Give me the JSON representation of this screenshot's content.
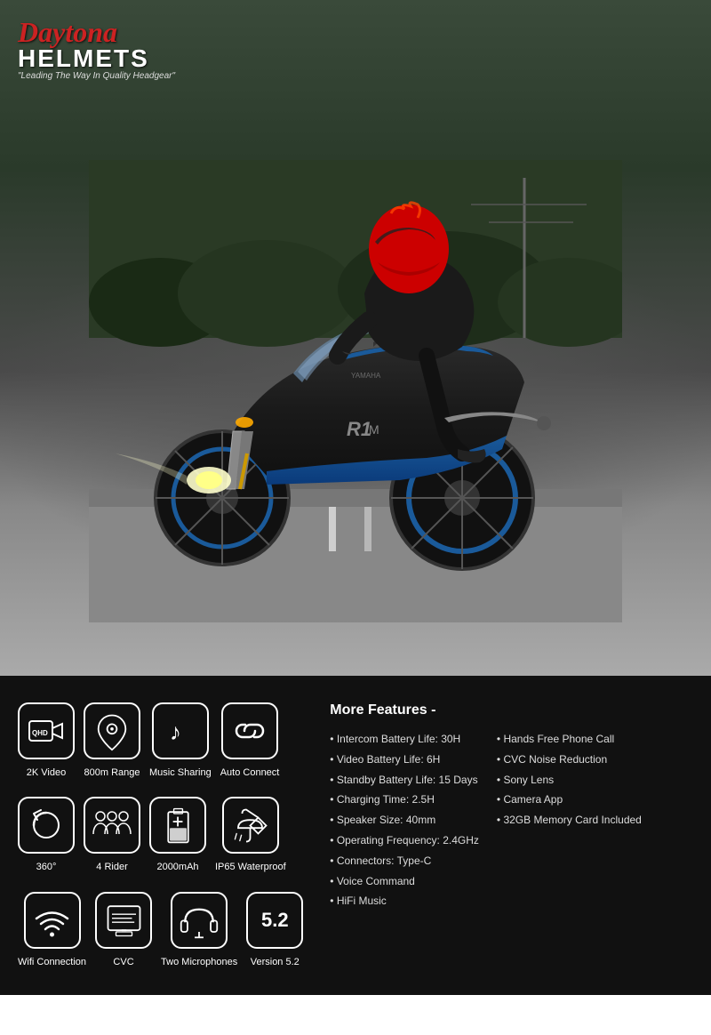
{
  "logo": {
    "brand": "Daytona",
    "helmets": "HELMETS",
    "tagline": "\"Leading The Way In Quality Headgear\""
  },
  "features_section": {
    "row1": [
      {
        "id": "2k-video",
        "label": "2K Video",
        "icon": "📹"
      },
      {
        "id": "800m-range",
        "label": "800m Range",
        "icon": "📍"
      },
      {
        "id": "music-sharing",
        "label": "Music Sharing",
        "icon": "🎵"
      },
      {
        "id": "auto-connect",
        "label": "Auto Connect",
        "icon": "🔗"
      }
    ],
    "row2": [
      {
        "id": "360",
        "label": "360°",
        "icon": "🔄"
      },
      {
        "id": "4-rider",
        "label": "4 Rider",
        "icon": "👥"
      },
      {
        "id": "2000mah",
        "label": "2000mAh",
        "icon": "🔋"
      },
      {
        "id": "ip65",
        "label": "IP65 Waterproof",
        "icon": "🌂"
      }
    ],
    "row3": [
      {
        "id": "wifi",
        "label": "Wifi Connection",
        "icon": "📶"
      },
      {
        "id": "cvc",
        "label": "CVC",
        "icon": "🎧"
      },
      {
        "id": "two-mics",
        "label": "Two Microphones",
        "icon": "🎙"
      },
      {
        "id": "version",
        "label": "Version 5.2",
        "icon": "5.2",
        "is_version": true
      }
    ]
  },
  "more_features": {
    "title": "More Features -",
    "col1": [
      "Intercom Battery Life: 30H",
      "Video Battery Life: 6H",
      "Standby Battery Life: 15 Days",
      "Charging Time: 2.5H",
      "Speaker Size: 40mm",
      "Operating Frequency: 2.4GHz",
      "Connectors: Type-C",
      "Voice Command",
      "HiFi Music"
    ],
    "col2": [
      "Hands Free Phone Call",
      "CVC Noise Reduction",
      "Sony Lens",
      "Camera App",
      "32GB Memory Card Included"
    ]
  }
}
